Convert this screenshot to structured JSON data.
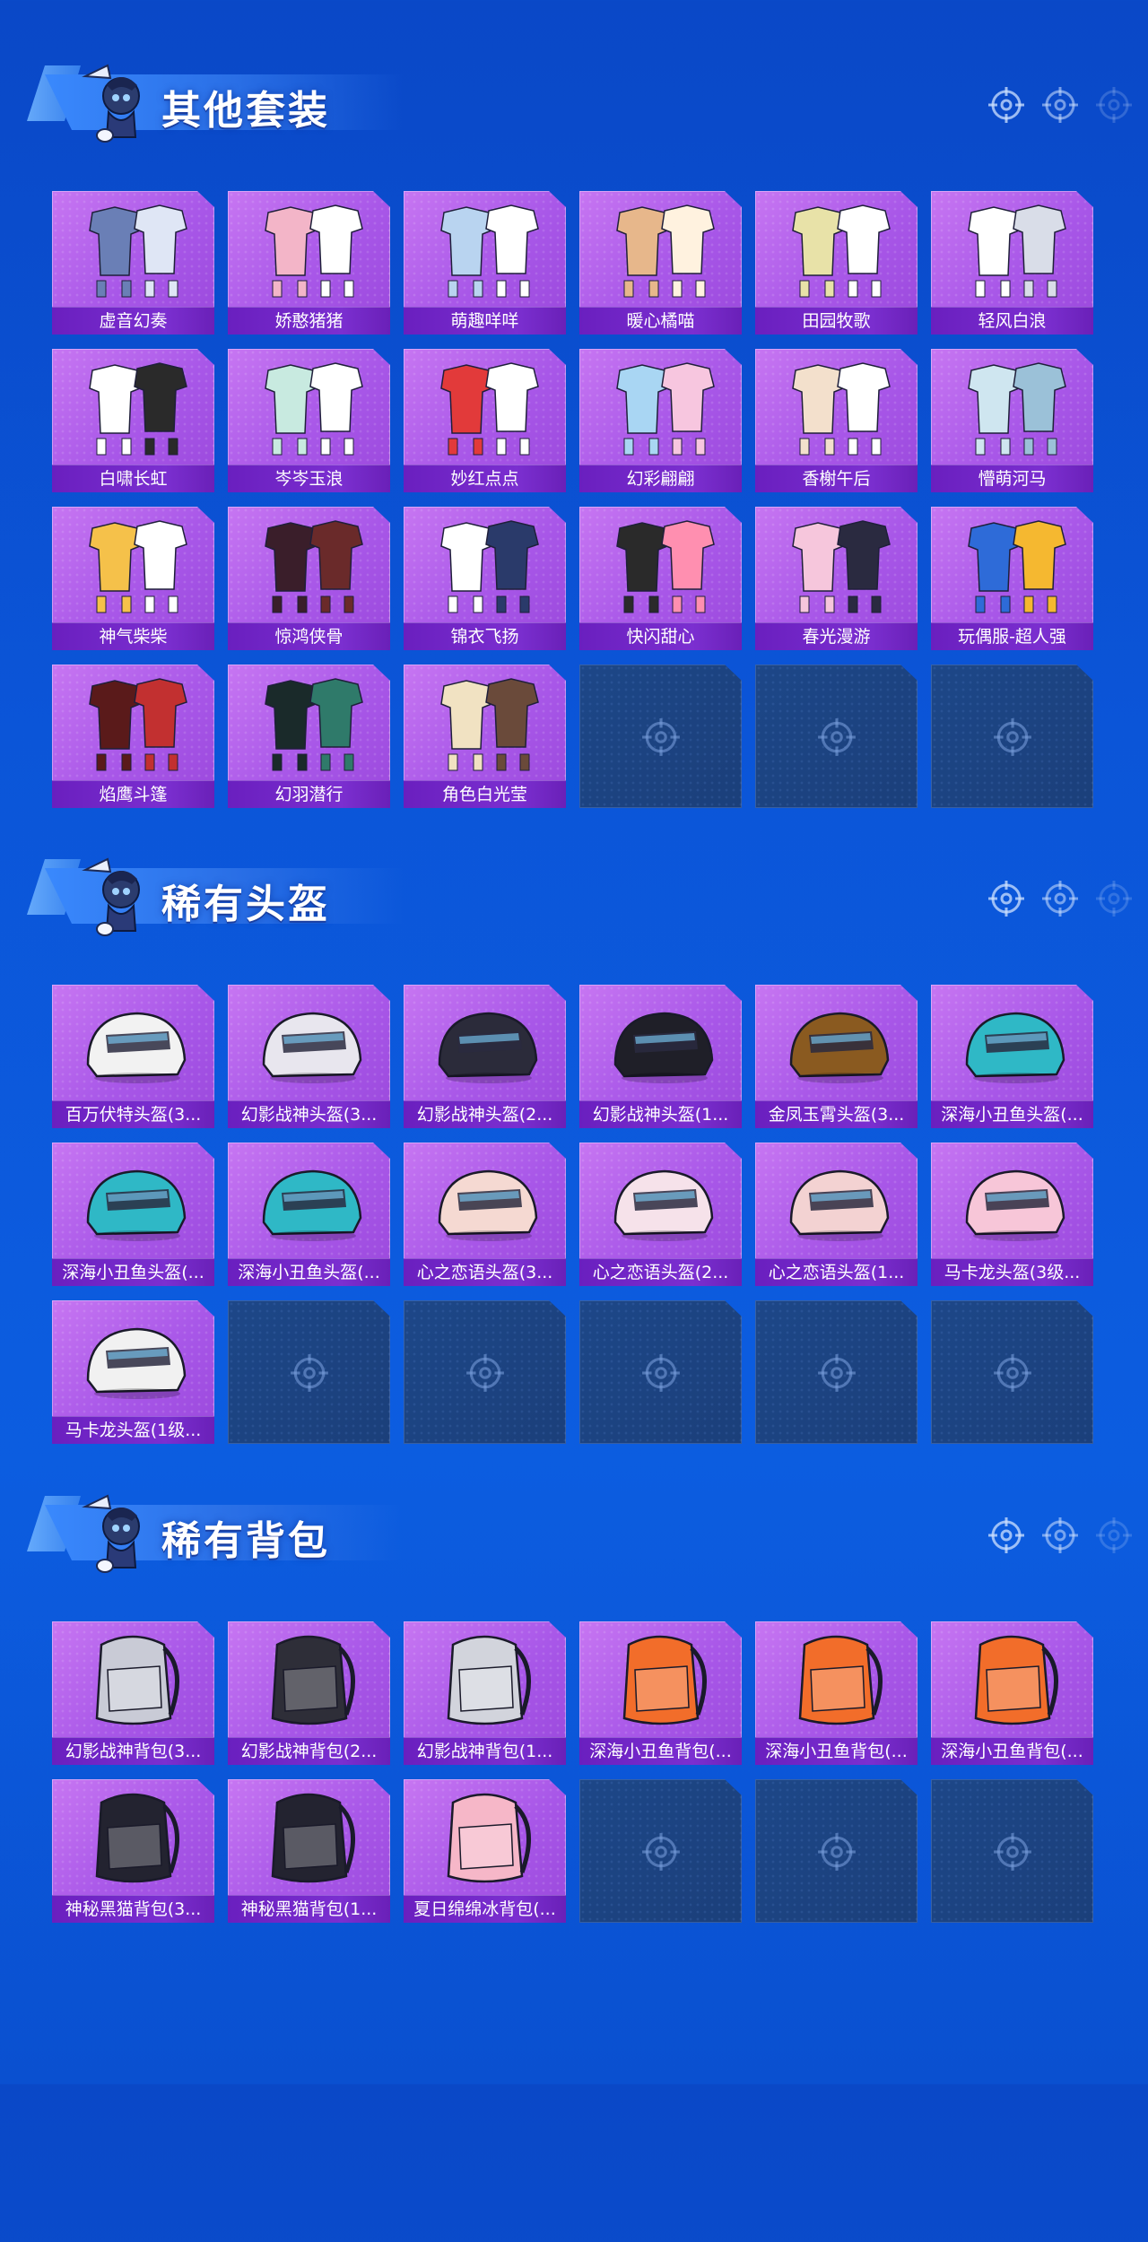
{
  "sections": [
    {
      "title": "其他套装",
      "items": [
        "虚音幻奏",
        "娇憨猪猪",
        "萌趣咩咩",
        "暖心橘喵",
        "田园牧歌",
        "轻风白浪",
        "白啸长虹",
        "岑岑玉浪",
        "妙红点点",
        "幻彩翩翩",
        "香榭午后",
        "懵萌河马",
        "神气柴柴",
        "惊鸿侠骨",
        "锦衣飞扬",
        "快闪甜心",
        "春光漫游",
        "玩偶服-超人强",
        "焰鹰斗篷",
        "幻羽潜行",
        "角色白光莹"
      ],
      "empty_slots": 3
    },
    {
      "title": "稀有头盔",
      "items": [
        "百万伏特头盔(3...",
        "幻影战神头盔(3...",
        "幻影战神头盔(2...",
        "幻影战神头盔(1...",
        "金凤玉霄头盔(3...",
        "深海小丑鱼头盔(...",
        "深海小丑鱼头盔(...",
        "深海小丑鱼头盔(...",
        "心之恋语头盔(3...",
        "心之恋语头盔(2...",
        "心之恋语头盔(1...",
        "马卡龙头盔(3级...",
        "马卡龙头盔(1级..."
      ],
      "empty_slots": 5
    },
    {
      "title": "稀有背包",
      "items": [
        "幻影战神背包(3...",
        "幻影战神背包(2...",
        "幻影战神背包(1...",
        "深海小丑鱼背包(...",
        "深海小丑鱼背包(...",
        "深海小丑鱼背包(...",
        "神秘黑猫背包(3...",
        "神秘黑猫背包(1...",
        "夏日绵绵冰背包(..."
      ],
      "empty_slots": 3
    }
  ],
  "icons": {
    "header_decor": "crosshair-icon",
    "empty_slot": "crosshair-icon",
    "mascot": "mascot-icon"
  },
  "colors": {
    "background": "#0b55d8",
    "card_purple": "#a857e8",
    "label_purple": "#7b2fd0",
    "empty_slot": "#1b3f7a"
  }
}
